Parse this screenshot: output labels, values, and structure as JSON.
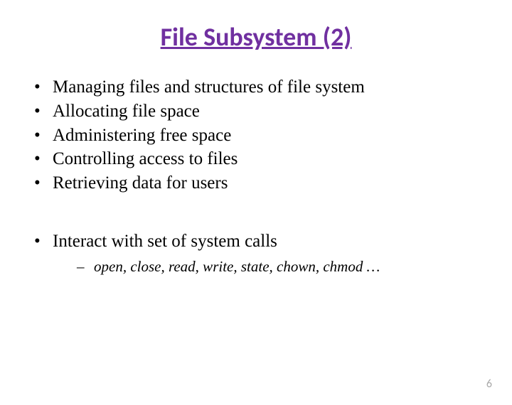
{
  "title": "File Subsystem (2)",
  "bullets": {
    "b0": "Managing files and structures of file system",
    "b1": "Allocating file space",
    "b2": "Administering free space",
    "b3": "Controlling access to files",
    "b4": "Retrieving data for users",
    "b5": "Interact with set of system calls",
    "sub0": "open, close, read, write, state, chown, chmod …"
  },
  "page_number": "6"
}
